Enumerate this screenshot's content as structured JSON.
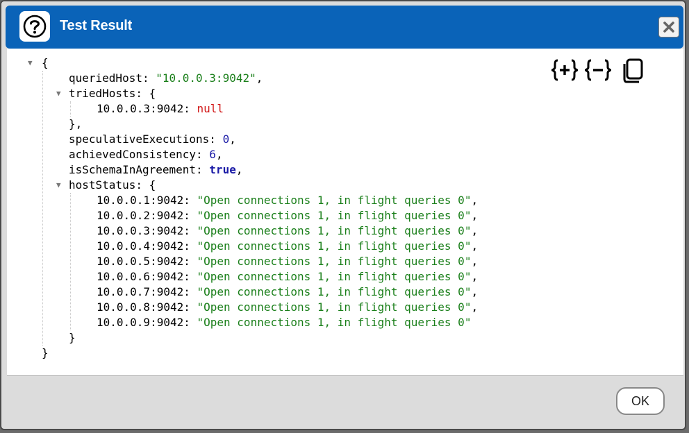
{
  "dialog": {
    "title": "Test Result",
    "ok_label": "OK"
  },
  "toolbar": {
    "expand_icon": "expand-all-icon",
    "collapse_icon": "collapse-all-icon",
    "copy_icon": "copy-icon"
  },
  "json": {
    "open_brace": "{",
    "close_brace": "}",
    "queriedHost": {
      "key": "queriedHost",
      "value": "\"10.0.0.3:9042\""
    },
    "triedHosts": {
      "key": "triedHosts",
      "entry_key": "10.0.0.3:9042",
      "entry_value": "null"
    },
    "speculativeExecutions": {
      "key": "speculativeExecutions",
      "value": "0"
    },
    "achievedConsistency": {
      "key": "achievedConsistency",
      "value": "6"
    },
    "isSchemaInAgreement": {
      "key": "isSchemaInAgreement",
      "value": "true"
    },
    "hostStatus": {
      "key": "hostStatus",
      "entries": [
        {
          "key": "10.0.0.1:9042",
          "value": "\"Open connections 1, in flight queries 0\""
        },
        {
          "key": "10.0.0.2:9042",
          "value": "\"Open connections 1, in flight queries 0\""
        },
        {
          "key": "10.0.0.3:9042",
          "value": "\"Open connections 1, in flight queries 0\""
        },
        {
          "key": "10.0.0.4:9042",
          "value": "\"Open connections 1, in flight queries 0\""
        },
        {
          "key": "10.0.0.5:9042",
          "value": "\"Open connections 1, in flight queries 0\""
        },
        {
          "key": "10.0.0.6:9042",
          "value": "\"Open connections 1, in flight queries 0\""
        },
        {
          "key": "10.0.0.7:9042",
          "value": "\"Open connections 1, in flight queries 0\""
        },
        {
          "key": "10.0.0.8:9042",
          "value": "\"Open connections 1, in flight queries 0\""
        },
        {
          "key": "10.0.0.9:9042",
          "value": "\"Open connections 1, in flight queries 0\""
        }
      ]
    }
  }
}
